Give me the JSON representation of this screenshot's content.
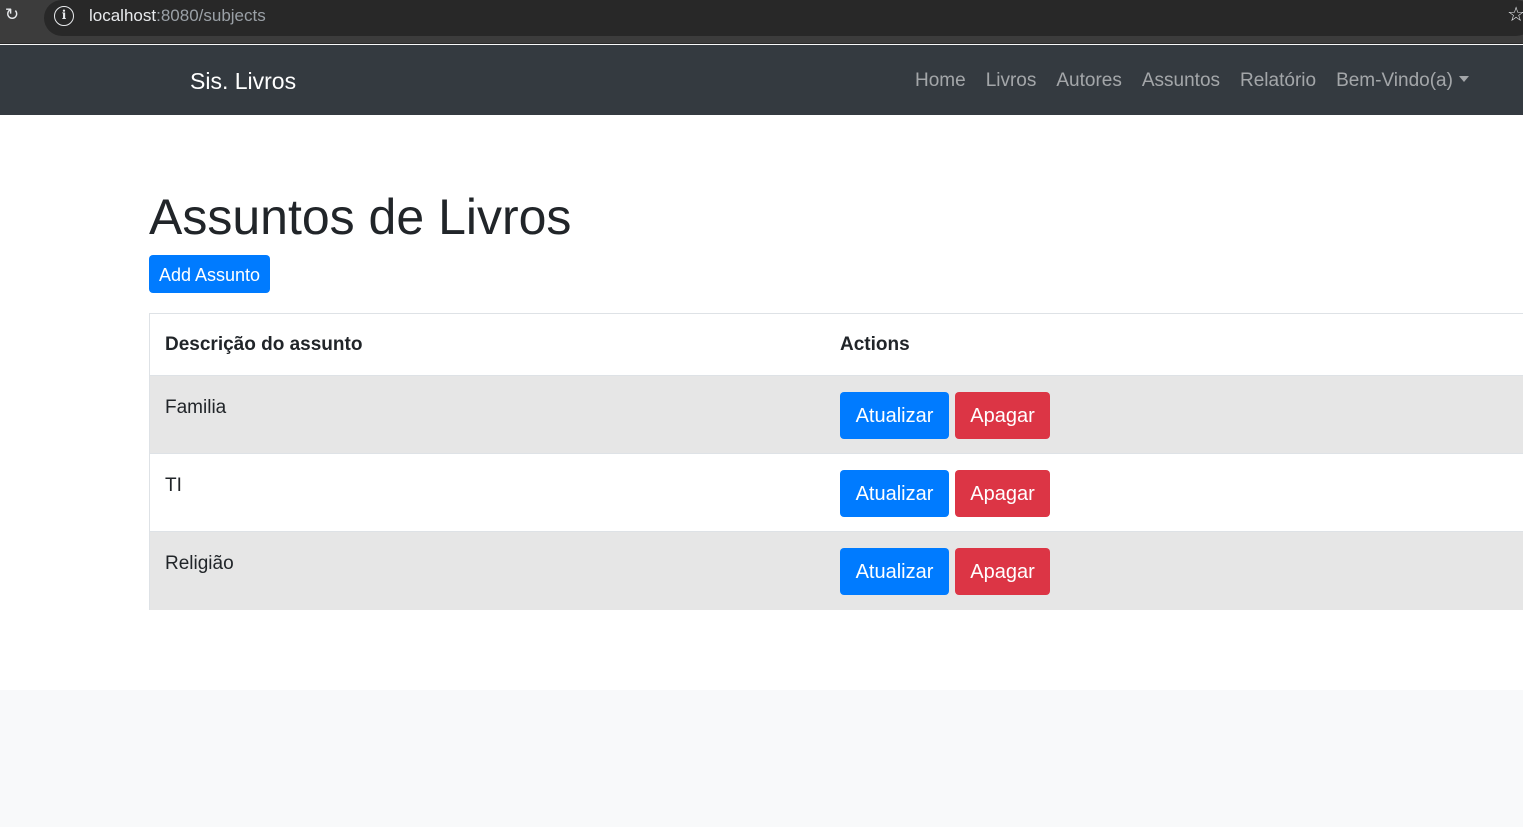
{
  "browser": {
    "url_host": "localhost",
    "url_rest": ":8080/subjects"
  },
  "navbar": {
    "brand": "Sis. Livros",
    "links": [
      {
        "label": "Home"
      },
      {
        "label": "Livros"
      },
      {
        "label": "Autores"
      },
      {
        "label": "Assuntos"
      },
      {
        "label": "Relatório"
      }
    ],
    "user_menu": "Bem-Vindo(a)"
  },
  "page": {
    "title": "Assuntos de Livros",
    "add_button": "Add Assunto"
  },
  "table": {
    "headers": {
      "description": "Descrição do assunto",
      "actions": "Actions"
    },
    "rows": [
      {
        "description": "Familia",
        "update": "Atualizar",
        "delete": "Apagar"
      },
      {
        "description": "TI",
        "update": "Atualizar",
        "delete": "Apagar"
      },
      {
        "description": "Religião",
        "update": "Atualizar",
        "delete": "Apagar"
      }
    ]
  },
  "icons": {
    "reload": "reload-icon",
    "info": "info-icon",
    "bookmark": "star-icon",
    "dropdown": "caret-down-icon"
  },
  "colors": {
    "navbar_bg": "#343a40",
    "primary": "#007bff",
    "danger": "#dc3545",
    "striped_row": "#e6e6e6"
  }
}
